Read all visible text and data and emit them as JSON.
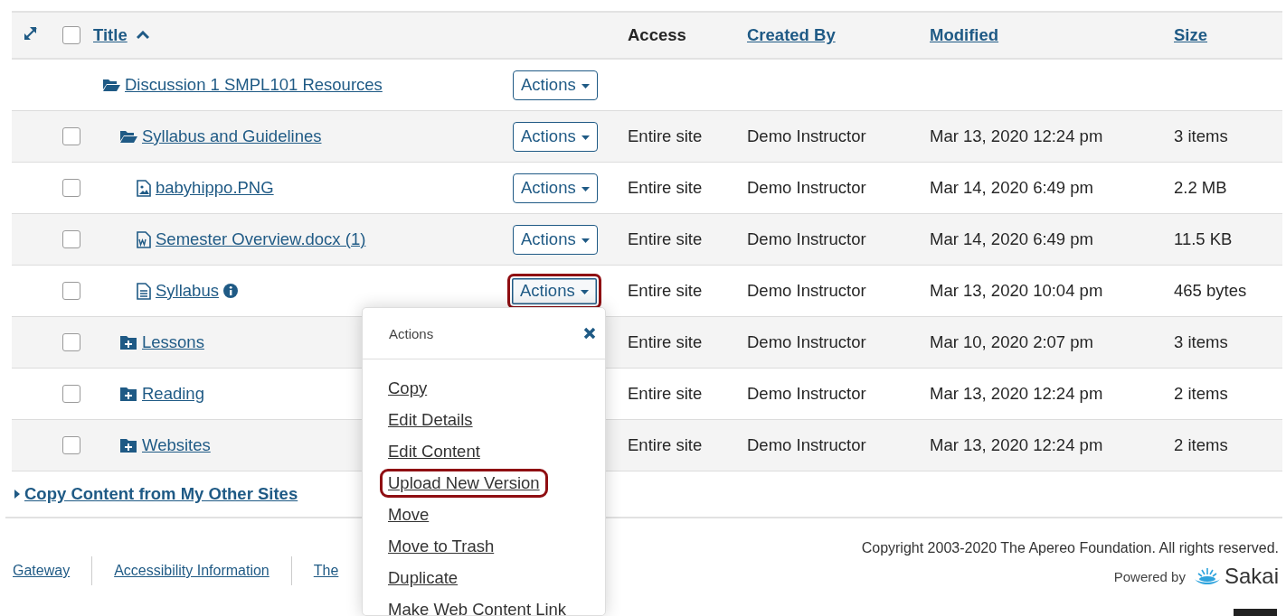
{
  "table": {
    "columns": [
      {
        "kind": "link",
        "label": "Title",
        "sorted": true
      },
      {
        "kind": "plain",
        "label": "Access",
        "sorted": false
      },
      {
        "kind": "link",
        "label": "Created By",
        "sorted": false
      },
      {
        "kind": "link",
        "label": "Modified",
        "sorted": false
      },
      {
        "kind": "link",
        "label": "Size",
        "sorted": false
      }
    ],
    "header_checkbox": {
      "checked": false
    },
    "rows": [
      {
        "kind": "folder-open",
        "title": "Discussion 1 SMPL101 Resources",
        "actions": "Actions",
        "menu_open": false,
        "children": [
          {
            "kind": "folder-open",
            "title": "Syllabus and Guidelines",
            "checked": false,
            "actions": "Actions",
            "menu_open": false,
            "access": "Entire site",
            "created_by": "Demo Instructor",
            "modified": "Mar 13, 2020 12:24 pm",
            "size": "3 items",
            "children": [
              {
                "kind": "image",
                "title": "babyhippo.PNG",
                "checked": false,
                "actions": "Actions",
                "menu_open": false,
                "access": "Entire site",
                "created_by": "Demo Instructor",
                "modified": "Mar 14, 2020 6:49 pm",
                "size": "2.2 MB"
              },
              {
                "kind": "word",
                "title": "Semester Overview.docx (1)",
                "checked": false,
                "actions": "Actions",
                "menu_open": false,
                "access": "Entire site",
                "created_by": "Demo Instructor",
                "modified": "Mar 14, 2020 6:49 pm",
                "size": "11.5 KB"
              },
              {
                "kind": "text",
                "title": "Syllabus",
                "info": true,
                "checked": false,
                "actions": "Actions",
                "menu_open": true,
                "access": "Entire site",
                "created_by": "Demo Instructor",
                "modified": "Mar 13, 2020 10:04 pm",
                "size": "465 bytes"
              }
            ]
          },
          {
            "kind": "folder-plus",
            "title": "Lessons",
            "checked": false,
            "access": "Entire site",
            "created_by": "Demo Instructor",
            "modified": "Mar 10, 2020 2:07 pm",
            "size": "3 items"
          },
          {
            "kind": "folder-plus",
            "title": "Reading",
            "checked": false,
            "access": "Entire site",
            "created_by": "Demo Instructor",
            "modified": "Mar 13, 2020 12:24 pm",
            "size": "2 items"
          },
          {
            "kind": "folder-plus",
            "title": "Websites",
            "checked": false,
            "access": "Entire site",
            "created_by": "Demo Instructor",
            "modified": "Mar 13, 2020 12:24 pm",
            "size": "2 items"
          }
        ]
      }
    ]
  },
  "copy_content": {
    "label": "Copy Content from My Other Sites",
    "expanded": false
  },
  "actions_menu": {
    "title": "Actions",
    "items": [
      {
        "label": "Copy",
        "highlighted": false
      },
      {
        "label": "Edit Details",
        "highlighted": false
      },
      {
        "label": "Edit Content",
        "highlighted": false
      },
      {
        "label": "Upload New Version",
        "highlighted": true
      },
      {
        "label": "Move",
        "highlighted": false
      },
      {
        "label": "Move to Trash",
        "highlighted": false
      },
      {
        "label": "Duplicate",
        "highlighted": false
      },
      {
        "label": "Make Web Content Link",
        "highlighted": false
      }
    ]
  },
  "footer": {
    "links": [
      "Gateway",
      "Accessibility Information",
      "The"
    ],
    "copyright": "Copyright 2003-2020 The Apereo Foundation. All rights reserved.",
    "powered_by": "Powered by",
    "logo": "Sakai"
  }
}
